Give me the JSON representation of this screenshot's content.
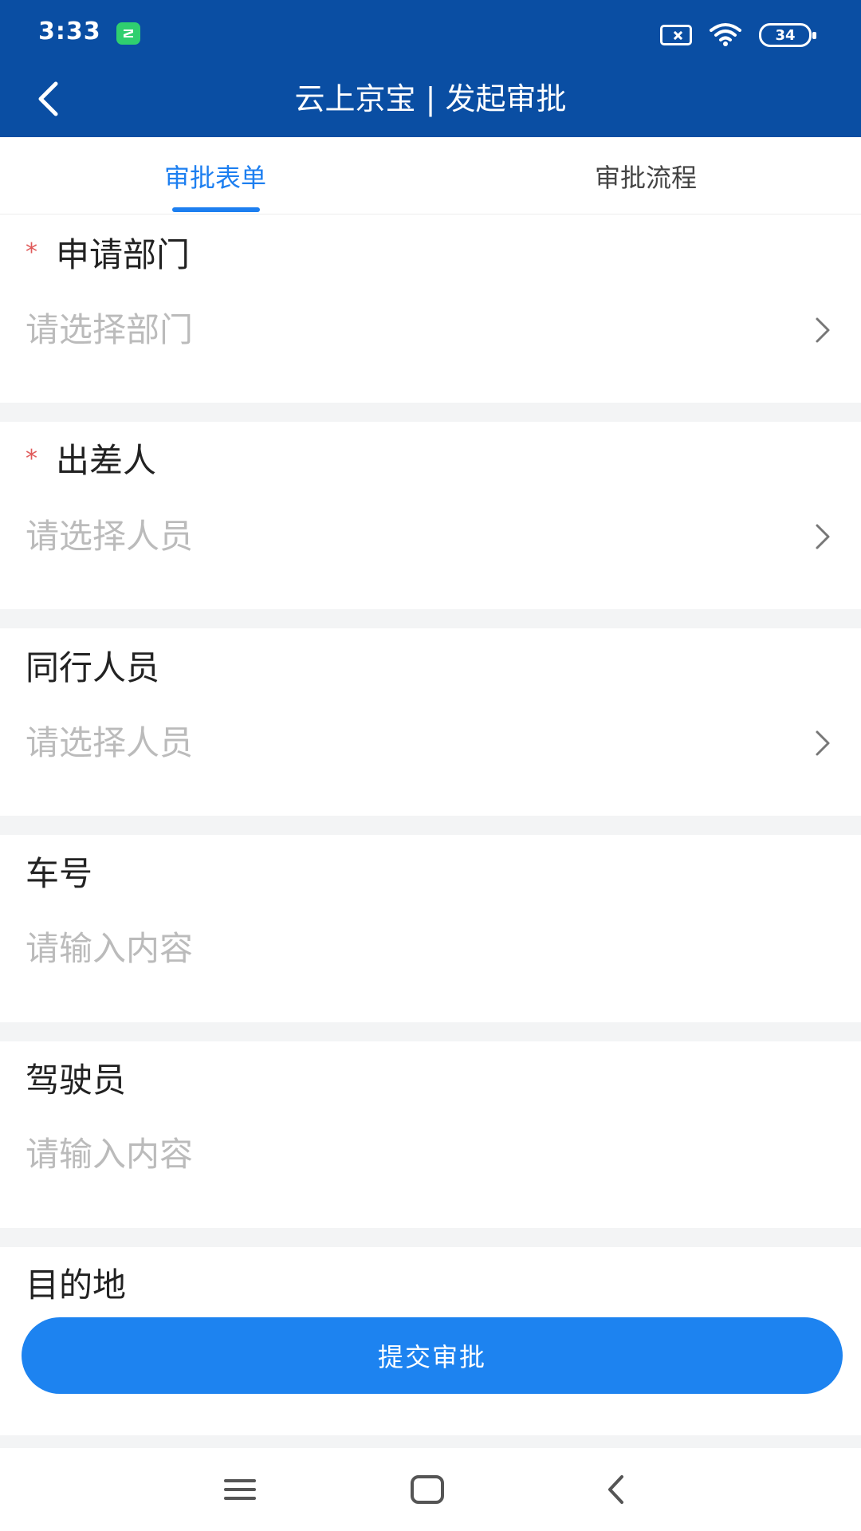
{
  "status_bar": {
    "time": "3:33",
    "battery": "34"
  },
  "header": {
    "title": "云上京宝 | 发起审批"
  },
  "tabs": [
    {
      "label": "审批表单",
      "active": true
    },
    {
      "label": "审批流程",
      "active": false
    }
  ],
  "form": {
    "fields": [
      {
        "label": "申请部门",
        "required": true,
        "value": "请选择部门",
        "type": "select"
      },
      {
        "label": "出差人",
        "required": true,
        "value": "请选择人员",
        "type": "select"
      },
      {
        "label": "同行人员",
        "required": false,
        "value": "请选择人员",
        "type": "select"
      },
      {
        "label": "车号",
        "required": false,
        "value": "请输入内容",
        "type": "input"
      },
      {
        "label": "驾驶员",
        "required": false,
        "value": "请输入内容",
        "type": "input"
      },
      {
        "label": "目的地",
        "required": false
      }
    ],
    "required_mark": "*"
  },
  "submit": {
    "label": "提交审批"
  },
  "colors": {
    "header_bg": "#0a4ea3",
    "accent": "#1d7ff0",
    "required": "#e05a5a",
    "placeholder": "#bbbbbb"
  },
  "icons": {
    "back": "chevron-left-icon",
    "row_arrow": "chevron-right-icon",
    "nav": [
      "menu-icon",
      "home-icon",
      "back-icon"
    ]
  }
}
